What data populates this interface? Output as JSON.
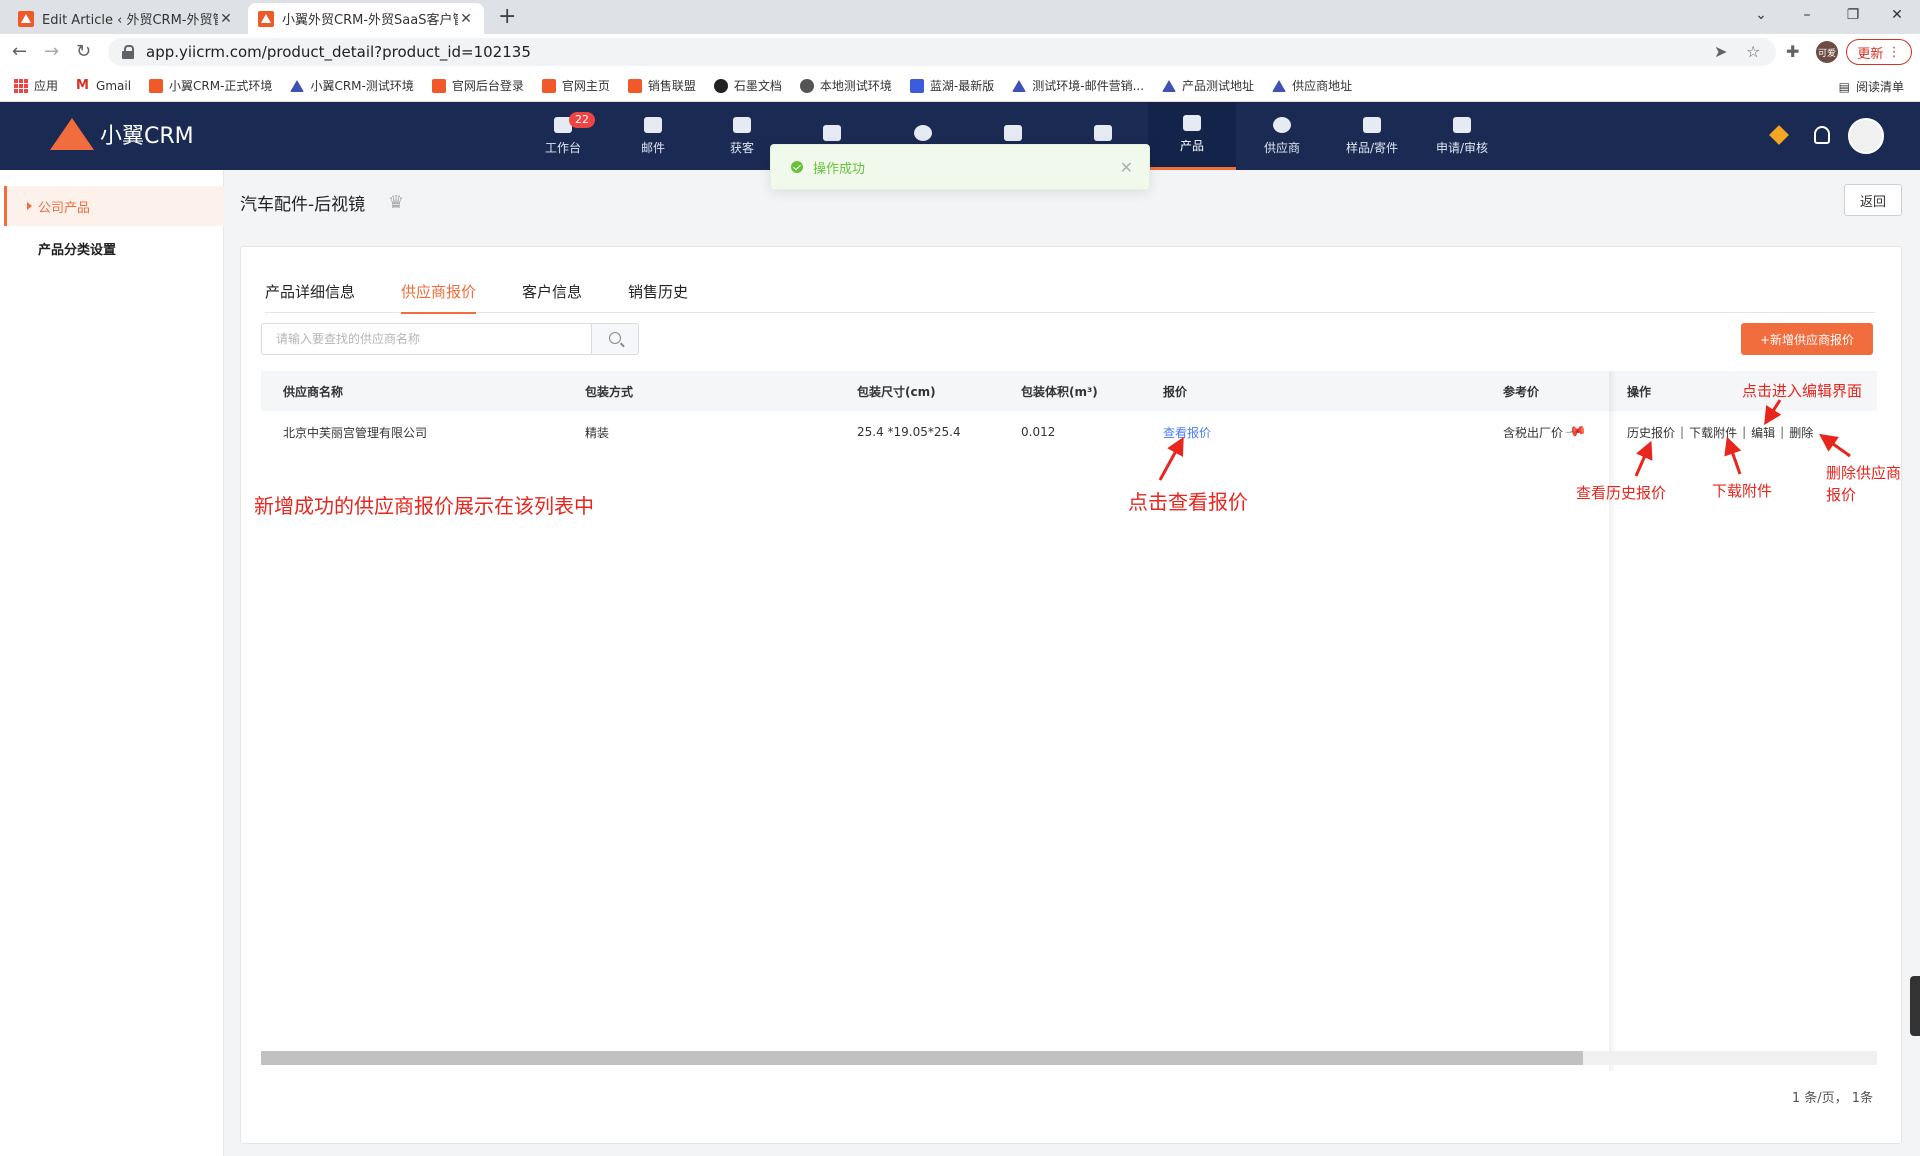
{
  "browser": {
    "tabs": [
      {
        "title": "Edit Article ‹ 外贸CRM-外贸管理"
      },
      {
        "title": "小翼外贸CRM-外贸SaaS客户管理"
      }
    ],
    "url": "app.yiicrm.com/product_detail?product_id=102135",
    "update_label": "更新",
    "avatar_text": "可爱",
    "bookmarks": [
      "应用",
      "Gmail",
      "小翼CRM-正式环境",
      "小翼CRM-测试环境",
      "官网后台登录",
      "官网主页",
      "销售联盟",
      "石墨文档",
      "本地测试环境",
      "蓝湖-最新版",
      "测试环境-邮件营销...",
      "产品测试地址",
      "供应商地址"
    ],
    "reading_list": "阅读清单"
  },
  "app": {
    "logo_text": "小翼CRM",
    "nav": [
      {
        "label": "工作台",
        "badge": "22"
      },
      {
        "label": "邮件"
      },
      {
        "label": "获客"
      },
      {
        "label": ""
      },
      {
        "label": ""
      },
      {
        "label": ""
      },
      {
        "label": ""
      },
      {
        "label": "产品"
      },
      {
        "label": "供应商"
      },
      {
        "label": "样品/寄件"
      },
      {
        "label": "申请/审核"
      }
    ],
    "toast": "操作成功"
  },
  "sidebar": {
    "items": [
      {
        "label": "公司产品"
      },
      {
        "label": "产品分类设置"
      }
    ]
  },
  "page": {
    "title": "汽车配件-后视镜",
    "back_label": "返回",
    "tabs": [
      "产品详细信息",
      "供应商报价",
      "客户信息",
      "销售历史"
    ],
    "search_placeholder": "请输入要查找的供应商名称",
    "add_label": "+新增供应商报价",
    "table": {
      "headers": [
        "供应商名称",
        "包装方式",
        "包装尺寸(cm)",
        "包装体积(m³)",
        "报价",
        "参考价",
        "操作"
      ],
      "rows": [
        {
          "supplier": "北京中芙丽宫管理有限公司",
          "packing": "精装",
          "size": "25.4 *19.05*25.4",
          "volume": "0.012",
          "quote": "查看报价",
          "ref_price": "含税出厂价",
          "ops": [
            "历史报价",
            "下载附件",
            "编辑",
            "删除"
          ]
        }
      ]
    },
    "pager": "1 条/页， 1条"
  },
  "annotations": {
    "list_note": "新增成功的供应商报价展示在该列表中",
    "view_quote": "点击查看报价",
    "edit": "点击进入编辑界面",
    "history": "查看历史报价",
    "download": "下载附件",
    "delete_line1": "删除供应商",
    "delete_line2": "报价"
  },
  "colors": {
    "accent": "#f26d3d",
    "header_bg": "#1a2a52",
    "link": "#4a7cf3",
    "annotation": "#e8261e",
    "success": "#67c23a"
  }
}
